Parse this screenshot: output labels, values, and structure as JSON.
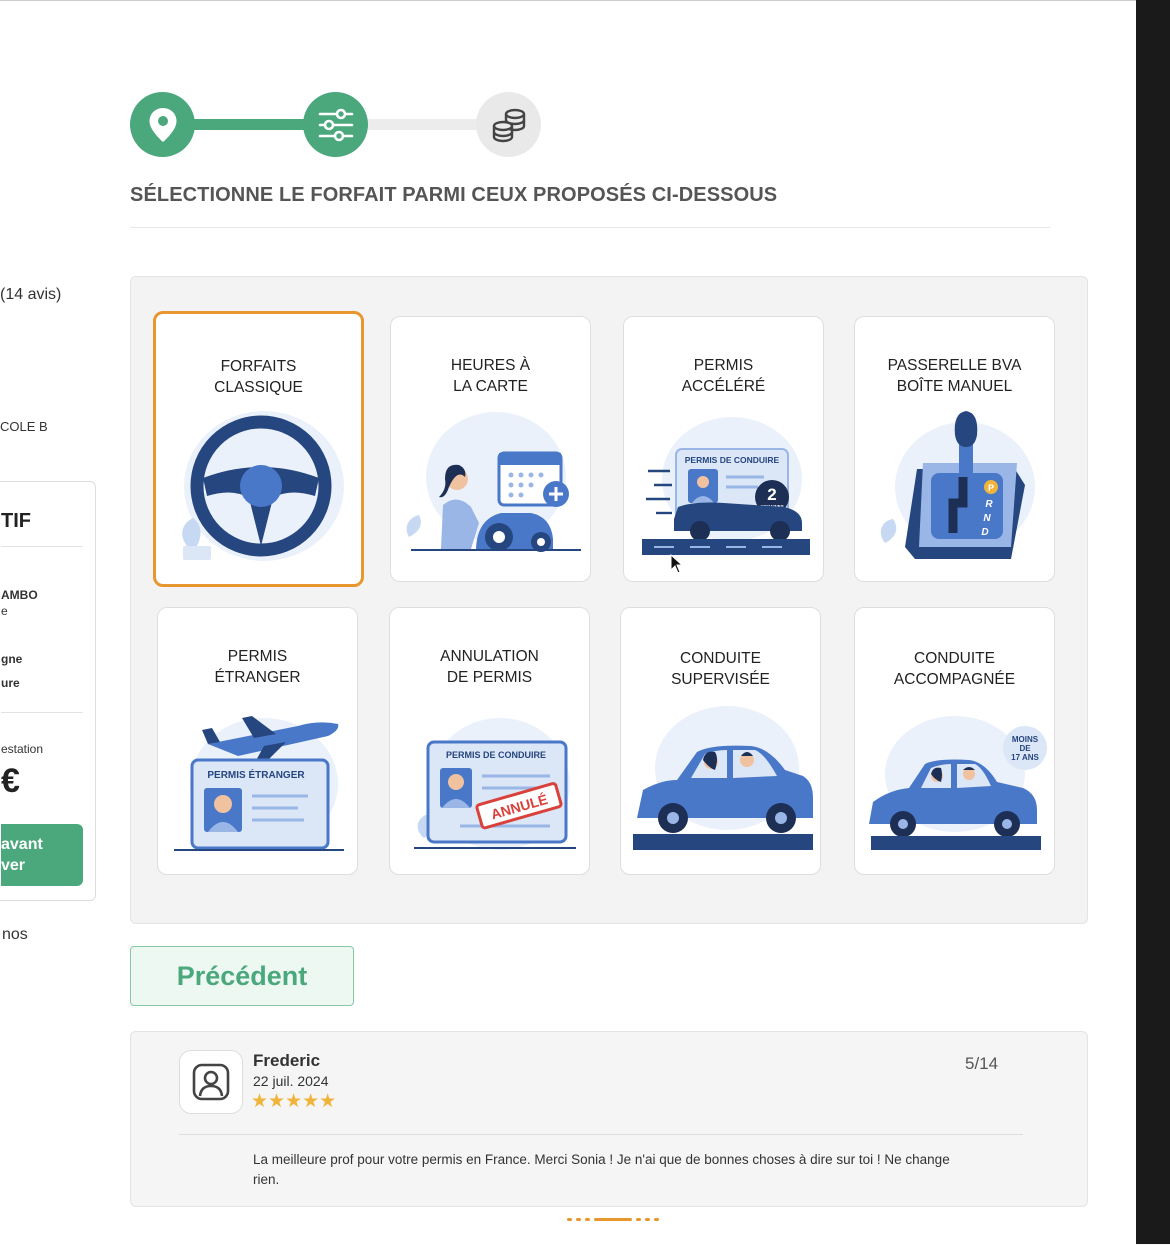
{
  "sidebar": {
    "reviews_count": "(14 avis)",
    "ecole_label": "COLE B",
    "card_header": "TIF",
    "line1": "AMBO",
    "line2": "e",
    "line3": "gne",
    "line4": "ure",
    "attest_label": "estation",
    "price_symbol": "€",
    "cta_line1": "avant",
    "cta_line2": "ver",
    "bottom_text": "nos"
  },
  "stepper": {
    "steps": [
      {
        "icon": "map-pin-icon",
        "state": "done"
      },
      {
        "icon": "sliders-icon",
        "state": "active"
      },
      {
        "icon": "coins-icon",
        "state": "pending"
      }
    ]
  },
  "page": {
    "title": "SÉLECTIONNE LE FORFAIT PARMI CEUX PROPOSÉS CI-DESSOUS"
  },
  "packages": [
    {
      "line1": "FORFAITS",
      "line2": "CLASSIQUE",
      "selected": true,
      "icon": "steering-wheel-icon"
    },
    {
      "line1": "HEURES À",
      "line2": "LA CARTE",
      "selected": false,
      "icon": "calendar-driver-icon"
    },
    {
      "line1": "PERMIS",
      "line2": "ACCÉLÉRÉ",
      "selected": false,
      "icon": "fast-car-icon",
      "badge_num": "2",
      "badge_text": "SEMAINES",
      "card_text": "PERMIS DE CONDUIRE"
    },
    {
      "line1": "PASSERELLE BVA",
      "line2": "BOÎTE MANUEL",
      "selected": false,
      "icon": "gear-shift-icon",
      "gears": [
        "P",
        "R",
        "N",
        "D"
      ]
    },
    {
      "line1": "PERMIS",
      "line2": "ÉTRANGER",
      "selected": false,
      "icon": "airplane-license-icon",
      "card_text": "PERMIS ÉTRANGER"
    },
    {
      "line1": "ANNULATION",
      "line2": "DE PERMIS",
      "selected": false,
      "icon": "cancelled-license-icon",
      "card_text": "PERMIS DE CONDUIRE",
      "stamp": "ANNULÉ"
    },
    {
      "line1": "CONDUITE",
      "line2": "SUPERVISÉE",
      "selected": false,
      "icon": "car-two-people-icon"
    },
    {
      "line1": "CONDUITE",
      "line2": "ACCOMPAGNÉE",
      "selected": false,
      "icon": "car-accompanied-icon",
      "bubble": [
        "MOINS",
        "DE",
        "17 ANS"
      ]
    }
  ],
  "buttons": {
    "previous": "Précédent"
  },
  "review": {
    "name": "Frederic",
    "date": "22 juil. 2024",
    "stars": "★★★★★",
    "rating": 5,
    "counter": "5/14",
    "text": "La meilleure prof pour votre permis en France. Merci Sonia ! Je n'ai que de bonnes choses à dire sur toi ! Ne change rien."
  },
  "colors": {
    "accent_green": "#4aa87c",
    "selected_orange": "#e8972f",
    "illustration_blue": "#4a78c9",
    "illustration_dark": "#25467f"
  }
}
